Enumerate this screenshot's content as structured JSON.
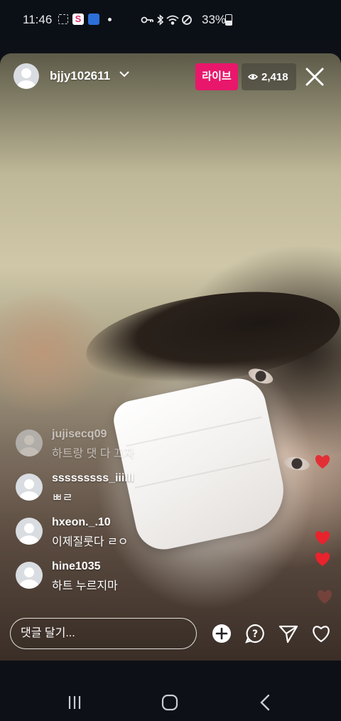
{
  "status_bar": {
    "time": "11:46",
    "battery": "33%",
    "icons": [
      "screenshot-frame-icon",
      "app-s-icon",
      "app-blue-icon",
      "dot-icon",
      "key-icon",
      "bluetooth-icon",
      "wifi-icon",
      "do-not-disturb-icon",
      "battery-icon"
    ]
  },
  "live_header": {
    "username": "bjjy102611",
    "live_label": "라이브",
    "viewer_count": "2,418",
    "colors": {
      "live_badge": "#e8176b"
    }
  },
  "comments": [
    {
      "user": "jujisecq09",
      "text": "하트랑 댓 다 끄자"
    },
    {
      "user": "sssssssss_iiilll",
      "text": "ㅃㄹ"
    },
    {
      "user": "hxeon._.10",
      "text": "이제질룻다 ㄹㅇ"
    },
    {
      "user": "hine1035",
      "text": "하트 누르지마"
    }
  ],
  "comment_input": {
    "placeholder": "댓글 달기..."
  },
  "actions": [
    "add-icon",
    "question-icon",
    "send-icon",
    "heart-icon"
  ],
  "nav_bar": [
    "recent-apps-icon",
    "home-icon",
    "back-icon"
  ]
}
